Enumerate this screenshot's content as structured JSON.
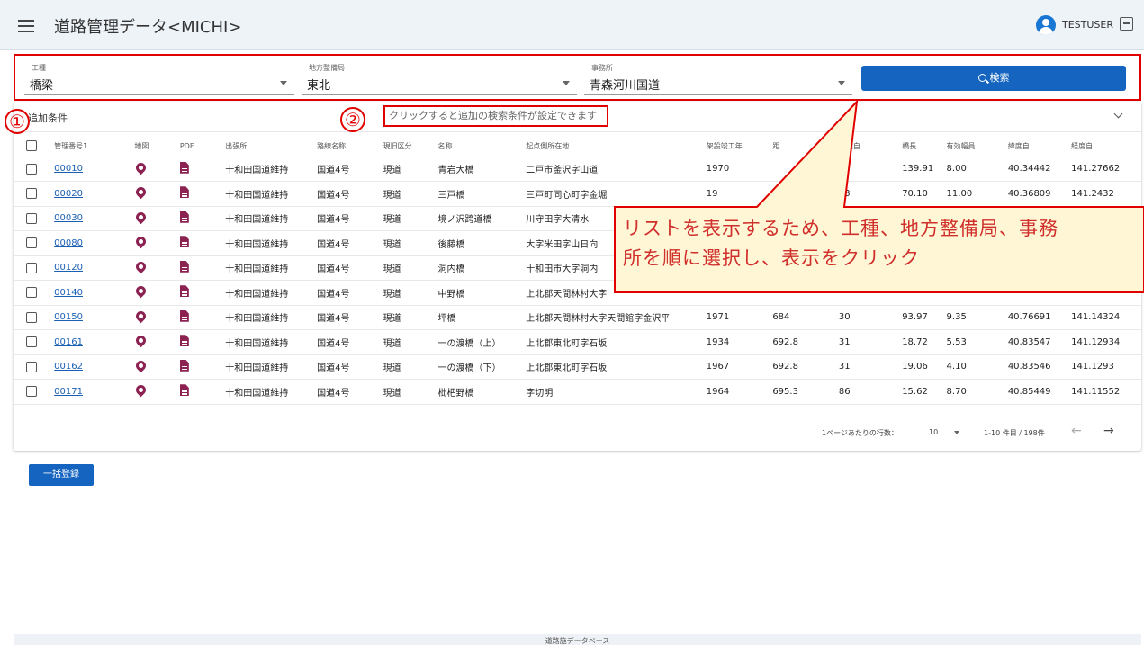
{
  "app": {
    "title": "道路管理データ<MICHI>",
    "username": "TESTUSER"
  },
  "search": {
    "field1": {
      "label": "工種",
      "value": "橋梁"
    },
    "field2": {
      "label": "地方整備局",
      "value": "東北"
    },
    "field3": {
      "label": "事務所",
      "value": "青森河川国道"
    },
    "button": "検索"
  },
  "addcond": {
    "label": "追加条件",
    "hint": "クリックすると追加の検索条件が設定できます"
  },
  "table": {
    "headers": [
      "管理番号1",
      "地図",
      "PDF",
      "出張所",
      "路線名称",
      "現旧区分",
      "名称",
      "起点側所在地",
      "架設竣工年",
      "距",
      "距離自",
      "橋長",
      "有効幅員",
      "緯度自",
      "経度自"
    ],
    "rows": [
      [
        "00010",
        "十和田国道維持",
        "国道4号",
        "現道",
        "青岩大橋",
        "二戸市釜沢字山道",
        "1970",
        "",
        "83",
        "139.91",
        "8.00",
        "40.34442",
        "141.27662"
      ],
      [
        "00020",
        "十和田国道維持",
        "国道4号",
        "現道",
        "三戸橋",
        "三戸町同心町字金堀",
        "19",
        "",
        "73",
        "70.10",
        "11.00",
        "40.36809",
        "141.2432"
      ],
      [
        "00030",
        "十和田国道維持",
        "国道4号",
        "現道",
        "境ノ沢跨道橋",
        "川守田字大清水",
        "",
        "",
        "",
        "",
        "",
        "",
        ""
      ],
      [
        "00080",
        "十和田国道維持",
        "国道4号",
        "現道",
        "後藤橋",
        "大字米田字山日向",
        "",
        "",
        "",
        "",
        "",
        "",
        ""
      ],
      [
        "00120",
        "十和田国道維持",
        "国道4号",
        "現道",
        "洞内橋",
        "十和田市大字洞内",
        "",
        "",
        "",
        "",
        "",
        "",
        ""
      ],
      [
        "00140",
        "十和田国道維持",
        "国道4号",
        "現道",
        "中野橋",
        "上北郡天間林村大字",
        "",
        "",
        "",
        "",
        "",
        "",
        ""
      ],
      [
        "00150",
        "十和田国道維持",
        "国道4号",
        "現道",
        "坪橋",
        "上北郡天間林村大字天間館字金沢平",
        "1971",
        "684",
        "30",
        "93.97",
        "9.35",
        "40.76691",
        "141.14324"
      ],
      [
        "00161",
        "十和田国道維持",
        "国道4号",
        "現道",
        "一の渡橋（上）",
        "上北郡東北町字石坂",
        "1934",
        "692.8",
        "31",
        "18.72",
        "5.53",
        "40.83547",
        "141.12934"
      ],
      [
        "00162",
        "十和田国道維持",
        "国道4号",
        "現道",
        "一の渡橋（下）",
        "上北郡東北町字石坂",
        "1967",
        "692.8",
        "31",
        "19.06",
        "4.10",
        "40.83546",
        "141.1293"
      ],
      [
        "00171",
        "十和田国道維持",
        "国道4号",
        "現道",
        "枇杷野橋",
        "字切明",
        "1964",
        "695.3",
        "86",
        "15.62",
        "8.70",
        "40.85449",
        "141.11552"
      ]
    ]
  },
  "pager": {
    "rows_per_page_label": "1ページあたりの行数：",
    "rows_per_page": "10",
    "range": "1-10 件目 / 198件"
  },
  "bulk_button": "一括登録",
  "footer": "道路施データベース",
  "annotations": {
    "num1": "①",
    "num2": "②",
    "callout_line1": "リストを表示するため、工種、地方整備局、事務",
    "callout_line2": "所を順に選択し、表示をクリック",
    "accent_color": "#e00000",
    "callout_bg": "#fff6d6"
  }
}
